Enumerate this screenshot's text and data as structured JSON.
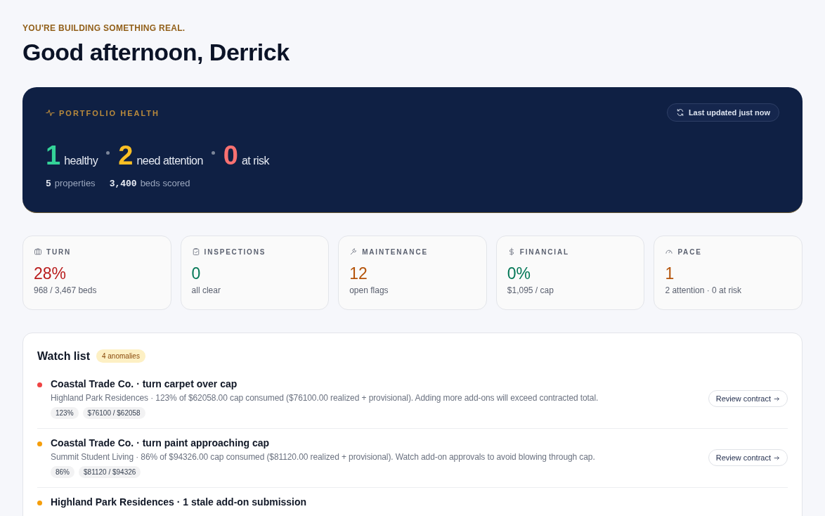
{
  "header": {
    "eyebrow": "YOU'RE BUILDING SOMETHING REAL.",
    "greeting": "Good afternoon, Derrick"
  },
  "health": {
    "title": "PORTFOLIO HEALTH",
    "refresh": "Last updated just now",
    "counts": [
      {
        "count": "1",
        "status": "healthy",
        "color": "#34d399"
      },
      {
        "count": "2",
        "status": "need attention",
        "color": "#fbbf24"
      },
      {
        "count": "0",
        "status": "at risk",
        "color": "#f87171"
      }
    ],
    "totals": [
      {
        "count": "5",
        "unit": "properties"
      },
      {
        "count": "3,400",
        "unit": "beds scored"
      }
    ]
  },
  "stats": [
    {
      "kind": "turn",
      "label": "TURN",
      "value": "28%",
      "sub": "968 / 3,467 beds",
      "color": "#b91c1c"
    },
    {
      "kind": "inspections",
      "label": "INSPECTIONS",
      "value": "0",
      "sub": "all clear",
      "color": "#047857"
    },
    {
      "kind": "maintenance",
      "label": "MAINTENANCE",
      "value": "12",
      "sub": "open flags",
      "color": "#b45309"
    },
    {
      "kind": "financial",
      "label": "FINANCIAL",
      "value": "0%",
      "sub": "$1,095 / cap",
      "color": "#047857"
    },
    {
      "kind": "pace",
      "label": "PACE",
      "value": "1",
      "sub": "2 attention · 0 at risk",
      "color": "#b45309"
    }
  ],
  "watch_list": {
    "title": "Watch list",
    "badge": "4 anomalies",
    "items": [
      {
        "color": "#ef4444",
        "title": "Coastal Trade Co. · turn carpet over cap",
        "detail": "Highland Park Residences · 123% of $62058.00 cap consumed ($76100.00 realized + provisional). Adding more add-ons will exceed contracted total.",
        "tags": [
          "123%",
          "$76100 / $62058"
        ],
        "action": "Review contract"
      },
      {
        "color": "#f59e0b",
        "title": "Coastal Trade Co. · turn paint approaching cap",
        "detail": "Summit Student Living · 86% of $94326.00 cap consumed ($81120.00 realized + provisional). Watch add-on approvals to avoid blowing through cap.",
        "tags": [
          "86%",
          "$81120 / $94326"
        ],
        "action": "Review contract"
      },
      {
        "color": "#f59e0b",
        "title": "Highland Park Residences · 1 stale add-on submission"
      }
    ]
  }
}
